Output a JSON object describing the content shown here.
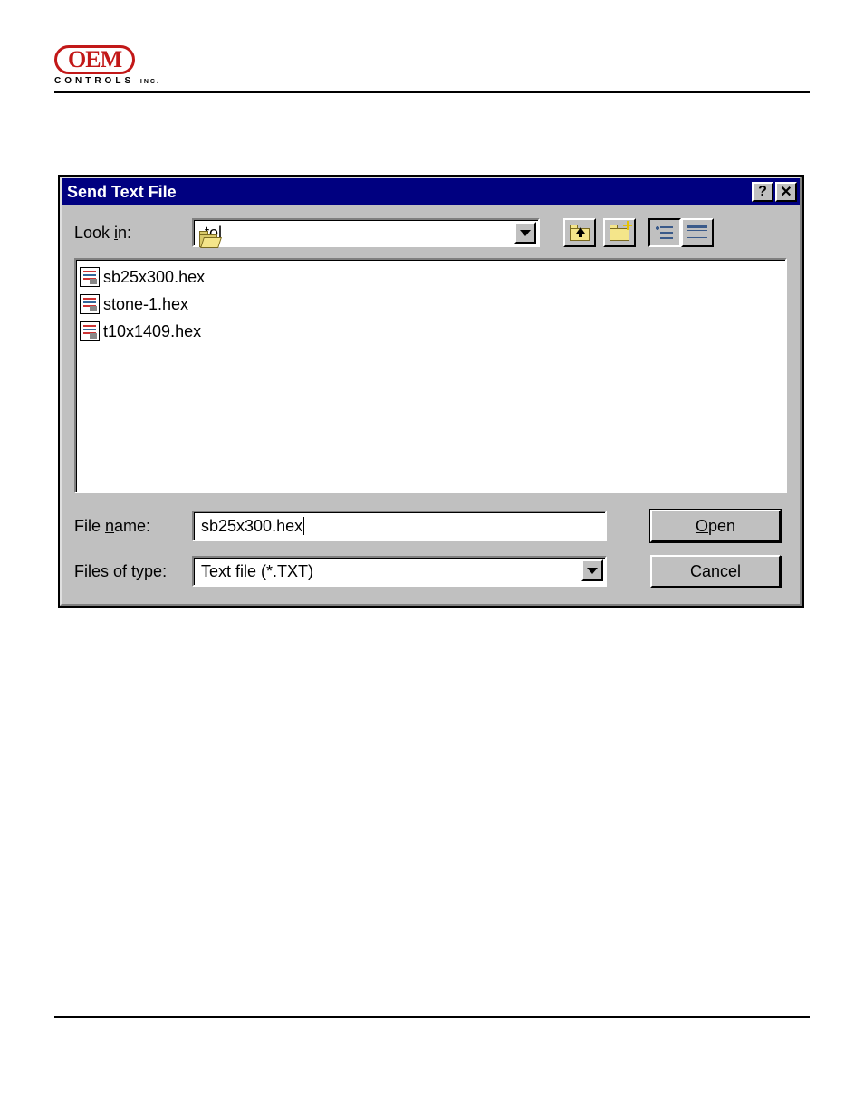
{
  "logo": {
    "top": "OEM",
    "bottom_main": "CONTROLS",
    "bottom_suffix": "INC."
  },
  "dialog": {
    "title": "Send Text File",
    "look_in_label_pre": "Look ",
    "look_in_label_ul": "i",
    "look_in_label_post": "n:",
    "look_in_value": "tol",
    "files": [
      {
        "name": "sb25x300.hex"
      },
      {
        "name": "stone-1.hex"
      },
      {
        "name": "t10x1409.hex"
      }
    ],
    "file_name_label_pre": "File ",
    "file_name_label_ul": "n",
    "file_name_label_post": "ame:",
    "file_name_value": "sb25x300.hex",
    "files_of_type_label_pre": "Files of ",
    "files_of_type_label_ul": "t",
    "files_of_type_label_post": "ype:",
    "files_of_type_value": "Text file (*.TXT)",
    "open_button_ul": "O",
    "open_button_post": "pen",
    "cancel_button": "Cancel",
    "help_glyph": "?",
    "close_glyph": "✕"
  }
}
